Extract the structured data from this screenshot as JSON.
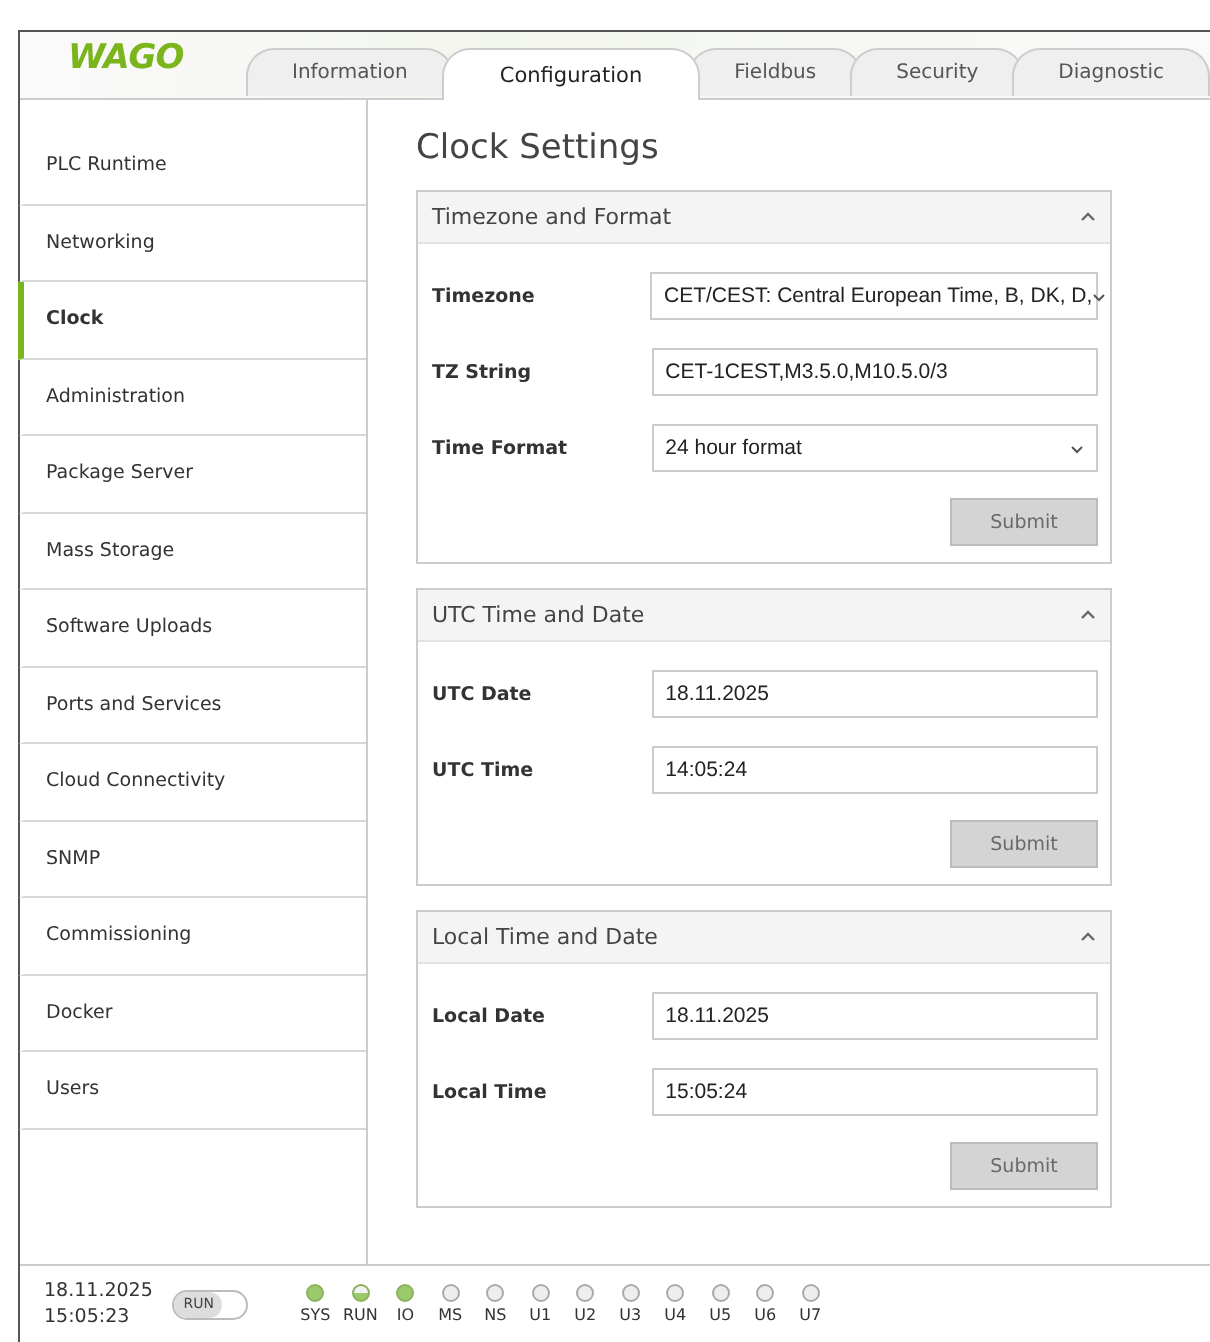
{
  "header": {
    "logo": "WAGO",
    "tabs": [
      {
        "label": "Information",
        "selected": false
      },
      {
        "label": "Configuration",
        "selected": true
      },
      {
        "label": "Fieldbus",
        "selected": false
      },
      {
        "label": "Security",
        "selected": false
      },
      {
        "label": "Diagnostic",
        "selected": false
      }
    ]
  },
  "sidebar": {
    "items": [
      {
        "label": "PLC Runtime",
        "selected": false
      },
      {
        "label": "Networking",
        "selected": false
      },
      {
        "label": "Clock",
        "selected": true
      },
      {
        "label": "Administration",
        "selected": false
      },
      {
        "label": "Package Server",
        "selected": false
      },
      {
        "label": "Mass Storage",
        "selected": false
      },
      {
        "label": "Software Uploads",
        "selected": false
      },
      {
        "label": "Ports and Services",
        "selected": false
      },
      {
        "label": "Cloud Connectivity",
        "selected": false
      },
      {
        "label": "SNMP",
        "selected": false
      },
      {
        "label": "Commissioning",
        "selected": false
      },
      {
        "label": "Docker",
        "selected": false
      },
      {
        "label": "Users",
        "selected": false
      }
    ]
  },
  "content": {
    "title": "Clock Settings",
    "panels": [
      {
        "title": "Timezone and Format",
        "expanded": true,
        "fields": [
          {
            "label": "Timezone",
            "kind": "select",
            "value": "CET/CEST: Central European Time, B, DK, D,"
          },
          {
            "label": "TZ String",
            "kind": "input",
            "value": "CET-1CEST,M3.5.0,M10.5.0/3"
          },
          {
            "label": "Time Format",
            "kind": "select",
            "value": "24 hour format"
          }
        ],
        "button": {
          "label": "Submit",
          "disabled": true
        }
      },
      {
        "title": "UTC Time and Date",
        "expanded": true,
        "fields": [
          {
            "label": "UTC Date",
            "kind": "input",
            "value": "18.11.2025"
          },
          {
            "label": "UTC Time",
            "kind": "input",
            "value": "14:05:24"
          }
        ],
        "button": {
          "label": "Submit",
          "disabled": true
        }
      },
      {
        "title": "Local Time and Date",
        "expanded": true,
        "fields": [
          {
            "label": "Local Date",
            "kind": "input",
            "value": "18.11.2025"
          },
          {
            "label": "Local Time",
            "kind": "input",
            "value": "15:05:24"
          }
        ],
        "button": {
          "label": "Submit",
          "disabled": true
        }
      }
    ]
  },
  "status_bar": {
    "date": "18.11.2025",
    "time": "15:05:23",
    "switch": {
      "label": "RUN",
      "on": false
    },
    "leds": [
      {
        "label": "SYS",
        "on": true,
        "partial": false
      },
      {
        "label": "RUN",
        "on": true,
        "partial": true
      },
      {
        "label": "IO",
        "on": true,
        "partial": false
      },
      {
        "label": "MS",
        "on": false,
        "partial": false
      },
      {
        "label": "NS",
        "on": false,
        "partial": false
      },
      {
        "label": "U1",
        "on": false,
        "partial": false
      },
      {
        "label": "U2",
        "on": false,
        "partial": false
      },
      {
        "label": "U3",
        "on": false,
        "partial": false
      },
      {
        "label": "U4",
        "on": false,
        "partial": false
      },
      {
        "label": "U5",
        "on": false,
        "partial": false
      },
      {
        "label": "U6",
        "on": false,
        "partial": false
      },
      {
        "label": "U7",
        "on": false,
        "partial": false
      }
    ]
  }
}
